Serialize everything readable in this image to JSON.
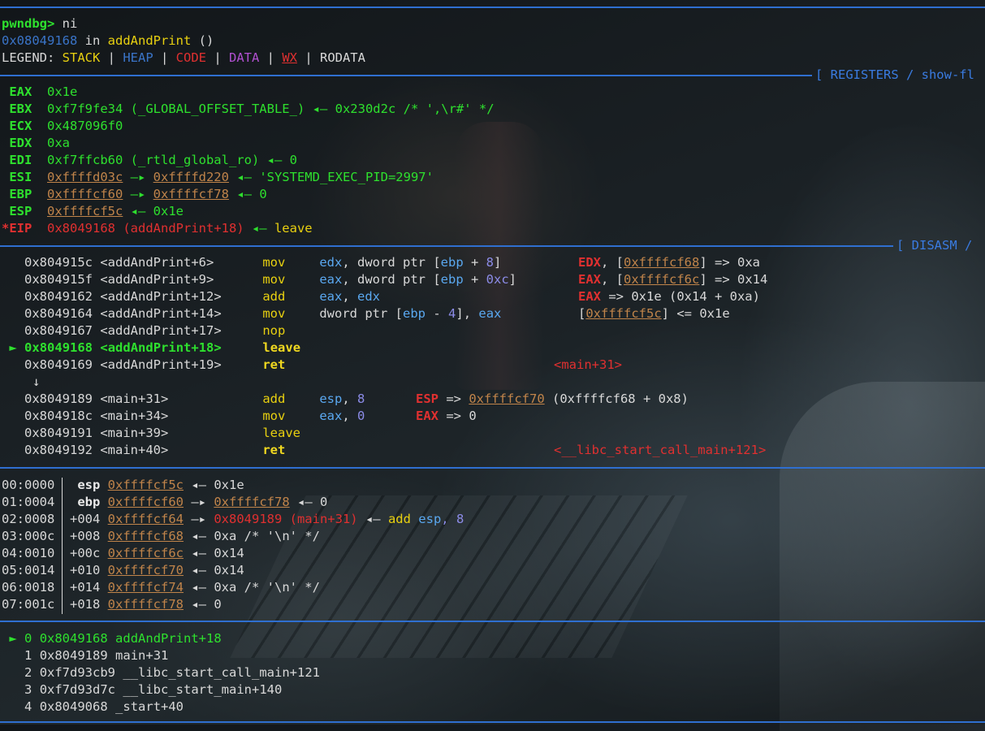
{
  "prompt": {
    "label": "pwndbg>",
    "command": " ni"
  },
  "location": {
    "addr": "0x08049168",
    "in": " in ",
    "func": "addAndPrint",
    "args": " ()"
  },
  "legend": {
    "label": "LEGEND: ",
    "items": [
      {
        "text": "STACK",
        "color": "#e8d010"
      },
      {
        "text": "HEAP",
        "color": "#3a74c8"
      },
      {
        "text": "CODE",
        "color": "#e03030"
      },
      {
        "text": "DATA",
        "color": "#b050d0"
      },
      {
        "text": "WX",
        "color": "#e03030"
      },
      {
        "text": "RODATA",
        "color": "#d8d8d8"
      }
    ],
    "sep": " | "
  },
  "headers": {
    "registers": "[ REGISTERS / show-fl",
    "disasm": "[ DISASM /"
  },
  "registers": {
    "eax": {
      "name": " EAX",
      "value": "0x1e"
    },
    "ebx": {
      "name": " EBX",
      "value": "0xf7f9fe34",
      "sym": " (_GLOBAL_OFFSET_TABLE_)",
      "arrow": " ◂— ",
      "rest": "0x230d2c /* ',\\r#' */"
    },
    "ecx": {
      "name": " ECX",
      "value": "0x487096f0"
    },
    "edx": {
      "name": " EDX",
      "value": "0xa"
    },
    "edi": {
      "name": " EDI",
      "value": "0xf7ffcb60",
      "sym": " (_rtld_global_ro)",
      "arrow": " ◂— ",
      "rest": "0"
    },
    "esi": {
      "name": " ESI",
      "value": "0xffffd03c",
      "arrow1": " —▸ ",
      "value2": "0xffffd220",
      "arrow2": " ◂— ",
      "rest": "'SYSTEMD_EXEC_PID=2997'"
    },
    "ebp": {
      "name": " EBP",
      "value": "0xffffcf60",
      "arrow1": " —▸ ",
      "value2": "0xffffcf78",
      "arrow2": " ◂— ",
      "rest": "0"
    },
    "esp": {
      "name": " ESP",
      "value": "0xffffcf5c",
      "arrow1": " ◂— ",
      "rest": "0x1e"
    },
    "eip": {
      "name": "*EIP",
      "value": "0x8049168",
      "sym": " (addAndPrint+18)",
      "arrow": " ◂— ",
      "rest": "leave"
    }
  },
  "disasm": [
    {
      "addr": "0x804915c",
      "sym": "<addAndPrint+6>",
      "op": "mov",
      "a1": "edx",
      "c1": ", ",
      "a2p": "dword ptr [",
      "a2r": "ebp",
      "a2m": " + ",
      "a2n": "8",
      "a2e": "]",
      "cr": "EDX",
      "cp": ", [",
      "ca": "0xffffcf68",
      "ce": "] => 0xa"
    },
    {
      "addr": "0x804915f",
      "sym": "<addAndPrint+9>",
      "op": "mov",
      "a1": "eax",
      "c1": ", ",
      "a2p": "dword ptr [",
      "a2r": "ebp",
      "a2m": " + ",
      "a2n": "0xc",
      "a2e": "]",
      "cr": "EAX",
      "cp": ", [",
      "ca": "0xffffcf6c",
      "ce": "] => 0x14"
    },
    {
      "addr": "0x8049162",
      "sym": "<addAndPrint+12>",
      "op": "add",
      "a1": "eax",
      "c1": ", ",
      "a2r": "edx",
      "cr": "EAX",
      "ce": " => 0x1e (0x14 + 0xa)"
    },
    {
      "addr": "0x8049164",
      "sym": "<addAndPrint+14>",
      "op": "mov",
      "a1p": "dword ptr [",
      "a1r": "ebp",
      "a1m": " - ",
      "a1n": "4",
      "a1e": "]",
      "c1": ", ",
      "a2r": "eax",
      "cp": "[",
      "ca": "0xffffcf5c",
      "ce": "] <= 0x1e"
    },
    {
      "addr": "0x8049167",
      "sym": "<addAndPrint+17>",
      "op": "nop"
    },
    {
      "marker": "►",
      "addr": "0x8049168",
      "sym": "<addAndPrint+18>",
      "op": "leave"
    },
    {
      "addr": "0x8049169",
      "sym": "<addAndPrint+19>",
      "op": "ret",
      "target": "<main+31>"
    },
    {
      "arrow": "↓"
    },
    {
      "addr": "0x8049189",
      "sym": "<main+31>",
      "op": "add",
      "a1": "esp",
      "c1": ", ",
      "a2n": "8",
      "cr": "ESP",
      "cp": " => ",
      "ca": "0xffffcf70",
      "ce": " (0xffffcf68 + 0x8)"
    },
    {
      "addr": "0x804918c",
      "sym": "<main+34>",
      "op": "mov",
      "a1": "eax",
      "c1": ", ",
      "a2n": "0",
      "cr": "EAX",
      "ce": " => 0"
    },
    {
      "addr": "0x8049191",
      "sym": "<main+39>",
      "op": "leave"
    },
    {
      "addr": "0x8049192",
      "sym": "<main+40>",
      "op": "ret",
      "target": "<__libc_start_call_main+121>"
    }
  ],
  "stack": [
    {
      "idx": "00:0000",
      "off": " esp",
      "addr": "0xffffcf5c",
      "a1": " ◂— ",
      "rest": "0x1e"
    },
    {
      "idx": "01:0004",
      "off": " ebp",
      "addr": "0xffffcf60",
      "a1": " —▸ ",
      "addr2": "0xffffcf78",
      "a2": " ◂— ",
      "rest": "0"
    },
    {
      "idx": "02:0008",
      "off": "+004",
      "addr": "0xffffcf64",
      "a1": " —▸ ",
      "code": "0x8049189 (main+31)",
      "a2": " ◂— ",
      "ins": "add ",
      "reg": "esp",
      "tail": ", 8"
    },
    {
      "idx": "03:000c",
      "off": "+008",
      "addr": "0xffffcf68",
      "a1": " ◂— ",
      "rest": "0xa /* '\\n' */"
    },
    {
      "idx": "04:0010",
      "off": "+00c",
      "addr": "0xffffcf6c",
      "a1": " ◂— ",
      "rest": "0x14"
    },
    {
      "idx": "05:0014",
      "off": "+010",
      "addr": "0xffffcf70",
      "a1": " ◂— ",
      "rest": "0x14"
    },
    {
      "idx": "06:0018",
      "off": "+014",
      "addr": "0xffffcf74",
      "a1": " ◂— ",
      "rest": "0xa /* '\\n' */"
    },
    {
      "idx": "07:001c",
      "off": "+018",
      "addr": "0xffffcf78",
      "a1": " ◂— ",
      "rest": "0"
    }
  ],
  "backtrace": [
    {
      "marker": " ► ",
      "n": "0",
      "addr": "0x8049168",
      "sym": "addAndPrint+18"
    },
    {
      "marker": "   ",
      "n": "1",
      "addr": "0x8049189",
      "sym": "main+31"
    },
    {
      "marker": "   ",
      "n": "2",
      "addr": "0xf7d93cb9",
      "sym": "__libc_start_call_main+121"
    },
    {
      "marker": "   ",
      "n": "3",
      "addr": "0xf7d93d7c",
      "sym": "__libc_start_main+140"
    },
    {
      "marker": "   ",
      "n": "4",
      "addr": "0x8049068",
      "sym": "_start+40"
    }
  ]
}
